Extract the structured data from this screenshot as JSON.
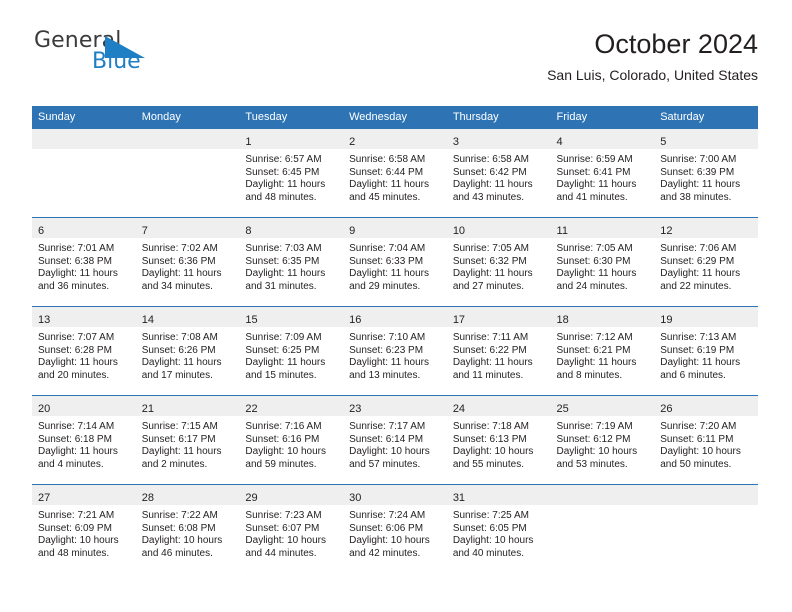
{
  "brand": {
    "name_top": "General",
    "name_bottom": "Blue",
    "triangle_icon": "triangle-logo-mark",
    "color_blue": "#1f7fc4",
    "color_dark": "#3b3b3b"
  },
  "header": {
    "title": "October 2024",
    "subtitle": "San Luis, Colorado, United States"
  },
  "theme": {
    "header_blue": "#2e74b5",
    "band_gray": "#efefef",
    "text": "#231f20"
  },
  "weekdays": [
    "Sunday",
    "Monday",
    "Tuesday",
    "Wednesday",
    "Thursday",
    "Friday",
    "Saturday"
  ],
  "weeks": [
    [
      {
        "day": "",
        "empty": true
      },
      {
        "day": "",
        "empty": true
      },
      {
        "day": "1",
        "sunrise": "Sunrise: 6:57 AM",
        "sunset": "Sunset: 6:45 PM",
        "daylight1": "Daylight: 11 hours",
        "daylight2": "and 48 minutes."
      },
      {
        "day": "2",
        "sunrise": "Sunrise: 6:58 AM",
        "sunset": "Sunset: 6:44 PM",
        "daylight1": "Daylight: 11 hours",
        "daylight2": "and 45 minutes."
      },
      {
        "day": "3",
        "sunrise": "Sunrise: 6:58 AM",
        "sunset": "Sunset: 6:42 PM",
        "daylight1": "Daylight: 11 hours",
        "daylight2": "and 43 minutes."
      },
      {
        "day": "4",
        "sunrise": "Sunrise: 6:59 AM",
        "sunset": "Sunset: 6:41 PM",
        "daylight1": "Daylight: 11 hours",
        "daylight2": "and 41 minutes."
      },
      {
        "day": "5",
        "sunrise": "Sunrise: 7:00 AM",
        "sunset": "Sunset: 6:39 PM",
        "daylight1": "Daylight: 11 hours",
        "daylight2": "and 38 minutes."
      }
    ],
    [
      {
        "day": "6",
        "sunrise": "Sunrise: 7:01 AM",
        "sunset": "Sunset: 6:38 PM",
        "daylight1": "Daylight: 11 hours",
        "daylight2": "and 36 minutes."
      },
      {
        "day": "7",
        "sunrise": "Sunrise: 7:02 AM",
        "sunset": "Sunset: 6:36 PM",
        "daylight1": "Daylight: 11 hours",
        "daylight2": "and 34 minutes."
      },
      {
        "day": "8",
        "sunrise": "Sunrise: 7:03 AM",
        "sunset": "Sunset: 6:35 PM",
        "daylight1": "Daylight: 11 hours",
        "daylight2": "and 31 minutes."
      },
      {
        "day": "9",
        "sunrise": "Sunrise: 7:04 AM",
        "sunset": "Sunset: 6:33 PM",
        "daylight1": "Daylight: 11 hours",
        "daylight2": "and 29 minutes."
      },
      {
        "day": "10",
        "sunrise": "Sunrise: 7:05 AM",
        "sunset": "Sunset: 6:32 PM",
        "daylight1": "Daylight: 11 hours",
        "daylight2": "and 27 minutes."
      },
      {
        "day": "11",
        "sunrise": "Sunrise: 7:05 AM",
        "sunset": "Sunset: 6:30 PM",
        "daylight1": "Daylight: 11 hours",
        "daylight2": "and 24 minutes."
      },
      {
        "day": "12",
        "sunrise": "Sunrise: 7:06 AM",
        "sunset": "Sunset: 6:29 PM",
        "daylight1": "Daylight: 11 hours",
        "daylight2": "and 22 minutes."
      }
    ],
    [
      {
        "day": "13",
        "sunrise": "Sunrise: 7:07 AM",
        "sunset": "Sunset: 6:28 PM",
        "daylight1": "Daylight: 11 hours",
        "daylight2": "and 20 minutes."
      },
      {
        "day": "14",
        "sunrise": "Sunrise: 7:08 AM",
        "sunset": "Sunset: 6:26 PM",
        "daylight1": "Daylight: 11 hours",
        "daylight2": "and 17 minutes."
      },
      {
        "day": "15",
        "sunrise": "Sunrise: 7:09 AM",
        "sunset": "Sunset: 6:25 PM",
        "daylight1": "Daylight: 11 hours",
        "daylight2": "and 15 minutes."
      },
      {
        "day": "16",
        "sunrise": "Sunrise: 7:10 AM",
        "sunset": "Sunset: 6:23 PM",
        "daylight1": "Daylight: 11 hours",
        "daylight2": "and 13 minutes."
      },
      {
        "day": "17",
        "sunrise": "Sunrise: 7:11 AM",
        "sunset": "Sunset: 6:22 PM",
        "daylight1": "Daylight: 11 hours",
        "daylight2": "and 11 minutes."
      },
      {
        "day": "18",
        "sunrise": "Sunrise: 7:12 AM",
        "sunset": "Sunset: 6:21 PM",
        "daylight1": "Daylight: 11 hours",
        "daylight2": "and 8 minutes."
      },
      {
        "day": "19",
        "sunrise": "Sunrise: 7:13 AM",
        "sunset": "Sunset: 6:19 PM",
        "daylight1": "Daylight: 11 hours",
        "daylight2": "and 6 minutes."
      }
    ],
    [
      {
        "day": "20",
        "sunrise": "Sunrise: 7:14 AM",
        "sunset": "Sunset: 6:18 PM",
        "daylight1": "Daylight: 11 hours",
        "daylight2": "and 4 minutes."
      },
      {
        "day": "21",
        "sunrise": "Sunrise: 7:15 AM",
        "sunset": "Sunset: 6:17 PM",
        "daylight1": "Daylight: 11 hours",
        "daylight2": "and 2 minutes."
      },
      {
        "day": "22",
        "sunrise": "Sunrise: 7:16 AM",
        "sunset": "Sunset: 6:16 PM",
        "daylight1": "Daylight: 10 hours",
        "daylight2": "and 59 minutes."
      },
      {
        "day": "23",
        "sunrise": "Sunrise: 7:17 AM",
        "sunset": "Sunset: 6:14 PM",
        "daylight1": "Daylight: 10 hours",
        "daylight2": "and 57 minutes."
      },
      {
        "day": "24",
        "sunrise": "Sunrise: 7:18 AM",
        "sunset": "Sunset: 6:13 PM",
        "daylight1": "Daylight: 10 hours",
        "daylight2": "and 55 minutes."
      },
      {
        "day": "25",
        "sunrise": "Sunrise: 7:19 AM",
        "sunset": "Sunset: 6:12 PM",
        "daylight1": "Daylight: 10 hours",
        "daylight2": "and 53 minutes."
      },
      {
        "day": "26",
        "sunrise": "Sunrise: 7:20 AM",
        "sunset": "Sunset: 6:11 PM",
        "daylight1": "Daylight: 10 hours",
        "daylight2": "and 50 minutes."
      }
    ],
    [
      {
        "day": "27",
        "sunrise": "Sunrise: 7:21 AM",
        "sunset": "Sunset: 6:09 PM",
        "daylight1": "Daylight: 10 hours",
        "daylight2": "and 48 minutes."
      },
      {
        "day": "28",
        "sunrise": "Sunrise: 7:22 AM",
        "sunset": "Sunset: 6:08 PM",
        "daylight1": "Daylight: 10 hours",
        "daylight2": "and 46 minutes."
      },
      {
        "day": "29",
        "sunrise": "Sunrise: 7:23 AM",
        "sunset": "Sunset: 6:07 PM",
        "daylight1": "Daylight: 10 hours",
        "daylight2": "and 44 minutes."
      },
      {
        "day": "30",
        "sunrise": "Sunrise: 7:24 AM",
        "sunset": "Sunset: 6:06 PM",
        "daylight1": "Daylight: 10 hours",
        "daylight2": "and 42 minutes."
      },
      {
        "day": "31",
        "sunrise": "Sunrise: 7:25 AM",
        "sunset": "Sunset: 6:05 PM",
        "daylight1": "Daylight: 10 hours",
        "daylight2": "and 40 minutes."
      },
      {
        "day": "",
        "empty": true
      },
      {
        "day": "",
        "empty": true
      }
    ]
  ]
}
